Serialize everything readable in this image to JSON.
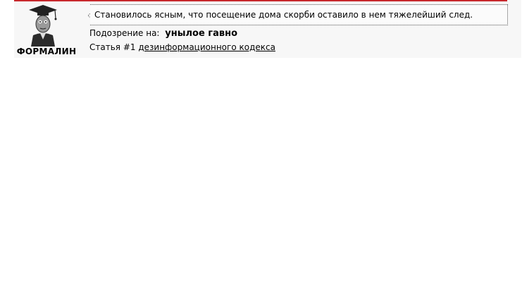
{
  "profile": {
    "username": "ФОРМАЛИН",
    "quote": "Становилось ясным, что посещение дома скорби оставило в нем тяжелейший след.",
    "suspicion_label": "Подозрение на:",
    "suspicion_value": "унылое гавно",
    "article_prefix": "Статья #1",
    "article_link": "дезинформационного кодекса"
  },
  "icons": {
    "avatar": "graduate-avatar-icon",
    "quote_tail": "speech-tail-icon"
  },
  "colors": {
    "accent_line": "#c8282c",
    "panel_bg": "#f7f7f7"
  }
}
